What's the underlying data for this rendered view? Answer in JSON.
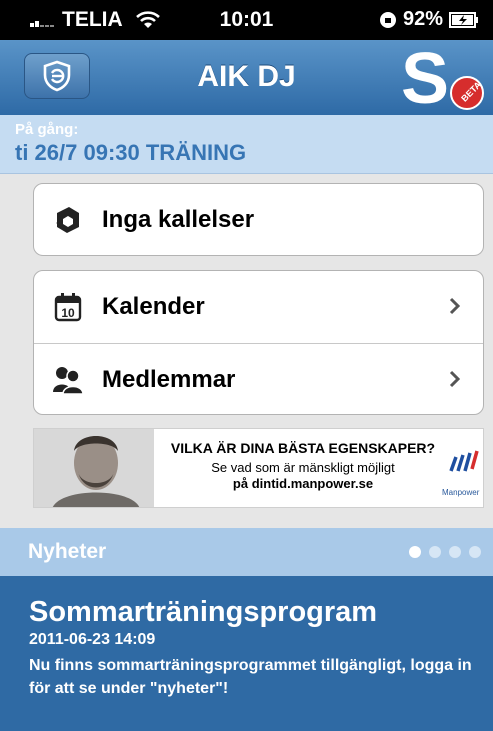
{
  "status_bar": {
    "carrier": "TELIA",
    "time": "10:01",
    "battery": "92%"
  },
  "navbar": {
    "title": "AIK DJ",
    "brand_letter": "S",
    "brand_badge": "BETA"
  },
  "upcoming": {
    "label": "På gång:",
    "event": "ti 26/7 09:30 TRÄNING"
  },
  "summons": {
    "label": "Inga kallelser"
  },
  "menu": {
    "calendar": {
      "label": "Kalender",
      "icon_day": "10"
    },
    "members": {
      "label": "Medlemmar"
    }
  },
  "ad": {
    "headline": "VILKA ÄR DINA BÄSTA EGENSKAPER?",
    "line1": "Se vad som är mänskligt möjligt",
    "line2": "på dintid.manpower.se",
    "logo_text": "Manpower"
  },
  "news": {
    "section_label": "Nyheter",
    "page_count": 4,
    "active_page": 1,
    "headline": "Sommarträningsprogram",
    "date": "2011-06-23 14:09",
    "body": "Nu finns sommarträningsprogrammet tillgängligt, logga in för att se under \"nyheter\"!"
  },
  "colors": {
    "nav_blue": "#2e6aa6",
    "upcoming_text": "#3775b4",
    "news_bg": "#2f6aa4",
    "brand_red": "#d62d2d"
  }
}
